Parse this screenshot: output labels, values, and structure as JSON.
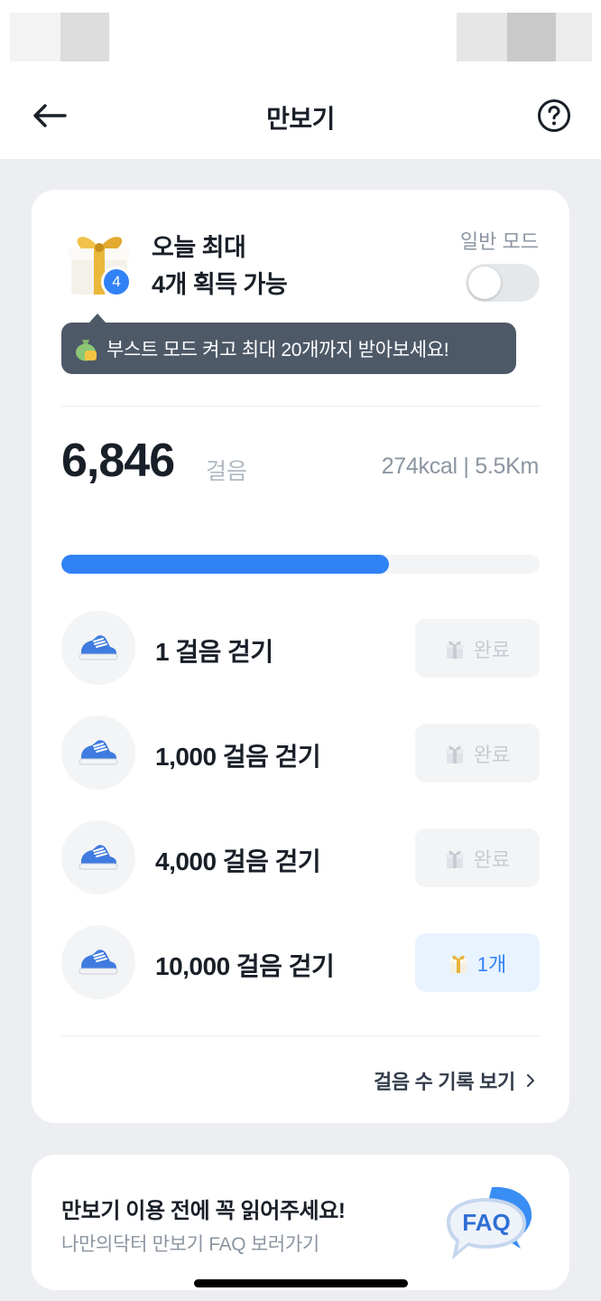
{
  "header": {
    "title": "만보기"
  },
  "reward": {
    "badge_count": "4",
    "line1": "오늘 최대",
    "line2": "4개 획득 가능",
    "mode_label": "일반 모드",
    "toggle_on": false,
    "tooltip": "부스트 모드 켜고 최대 20개까지 받아보세요!"
  },
  "steps": {
    "count": "6,846",
    "unit": "걸음",
    "meta": "274kcal | 5.5Km",
    "progress_percent": 68.5
  },
  "missions": [
    {
      "label": "1 걸음 걷기",
      "status": "완료",
      "state": "done"
    },
    {
      "label": "1,000 걸음 걷기",
      "status": "완료",
      "state": "done"
    },
    {
      "label": "4,000 걸음 걷기",
      "status": "완료",
      "state": "done"
    },
    {
      "label": "10,000 걸음 걷기",
      "status": "1개",
      "state": "active"
    }
  ],
  "history_link": "걸음 수 기록 보기",
  "faq": {
    "title": "만보기 이용 전에 꼭 읽어주세요!",
    "subtitle": "나만의닥터 만보기 FAQ 보러가기",
    "badge_text": "FAQ"
  },
  "colors": {
    "accent": "#3182f6",
    "tooltip_bg": "#4e5968",
    "page_bg": "#eceef1"
  }
}
